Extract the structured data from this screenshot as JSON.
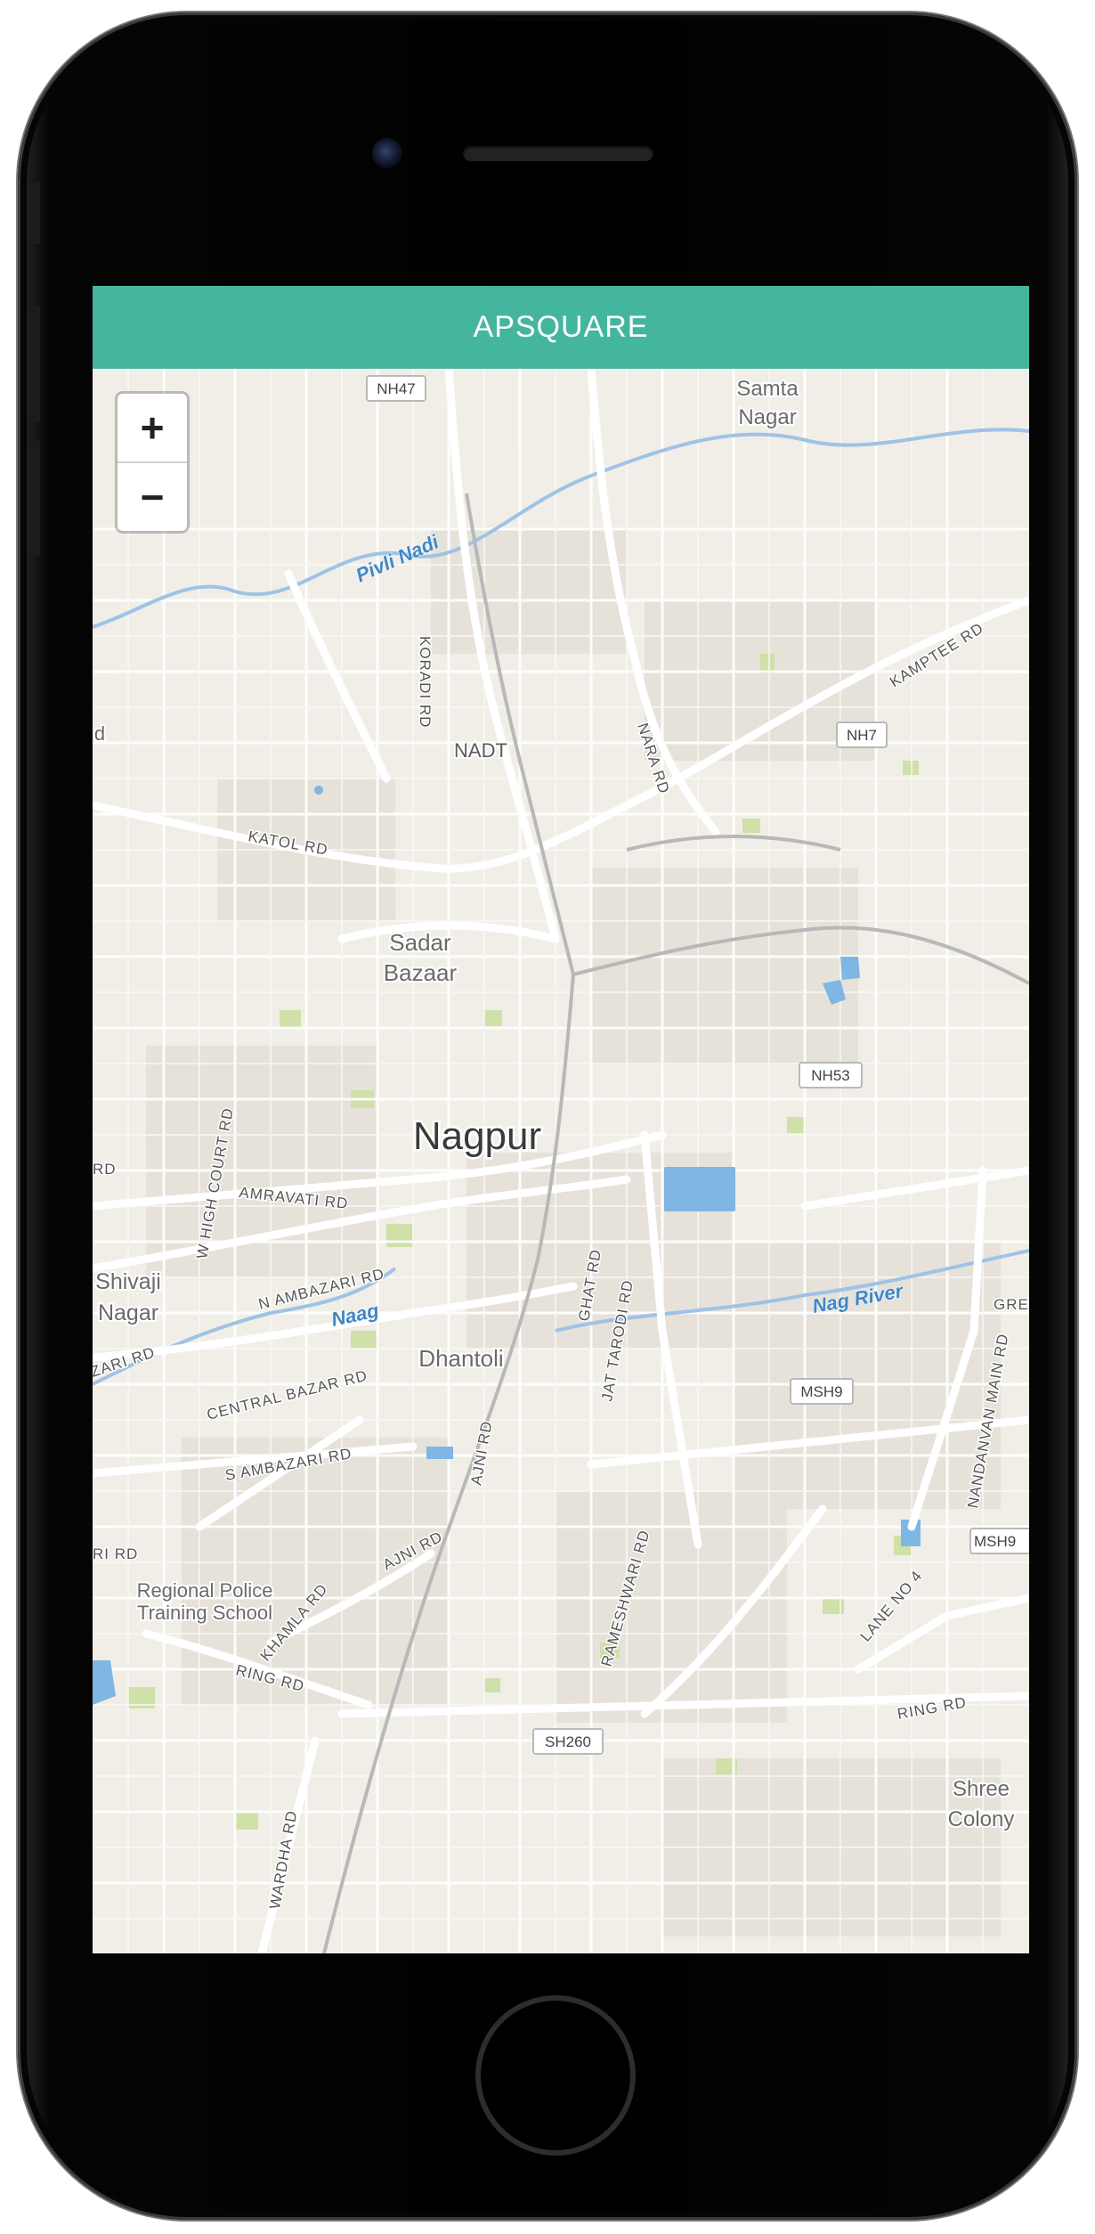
{
  "app": {
    "title": "APSQUARE"
  },
  "zoom": {
    "in_label": "+",
    "out_label": "−"
  },
  "map": {
    "city": "Nagpur",
    "places": {
      "samta": "Samta",
      "nagar1": "Nagar",
      "nadt": "NADT",
      "sadar": "Sadar",
      "bazaar": "Bazaar",
      "shivaji": "Shivaji",
      "nagar2": "Nagar",
      "dhantoli": "Dhantoli",
      "police1": "Regional Police",
      "police2": "Training School",
      "shree": "Shree",
      "colony": "Colony",
      "edge_d1": "d",
      "edge_rd1": "RD",
      "edge_rd2": "RI RD"
    },
    "roads": {
      "koradi": "KORADI RD",
      "katol": "KATOL RD",
      "nara": "NARA RD",
      "kamptee": "KAMPTEE RD",
      "high_court": "W HIGH COURT RD",
      "amravati": "AMRAVATI RD",
      "n_ambazari": "N AMBAZARI RD",
      "central_bazar": "CENTRAL BAZAR RD",
      "s_ambazari": "S AMBAZARI RD",
      "ajni_rd": "AJNI RD",
      "ajni_rd2": "AJNI RD",
      "khamla": "KHAMLA RD",
      "ring_left": "RING RD",
      "ring_right": "RING RD",
      "wardha": "WARDHA RD",
      "ghat": "GHAT RD",
      "jat_tarodi": "JAT TARODI RD",
      "rameshwari": "RAMESHWARI RD",
      "lane_no": "LANE NO 4",
      "nandanvan": "NANDANVAN MAIN RD",
      "gre": "GRE",
      "zari": "ZARI RD"
    },
    "shields": {
      "nh47": "NH47",
      "nh7": "NH7",
      "nh53": "NH53",
      "msh9": "MSH9",
      "msh9b": "MSH9",
      "sh260": "SH260"
    },
    "rivers": {
      "pivli": "Pivli Nadi",
      "naag": "Naag",
      "nag_river": "Nag River"
    }
  },
  "colors": {
    "header": "#45b69e",
    "land": "#f1eee8",
    "water": "#7fb6e3",
    "river": "#9ec3e6",
    "park": "#cfe0a8",
    "road": "#ffffff",
    "rail": "#b8b8b8"
  }
}
